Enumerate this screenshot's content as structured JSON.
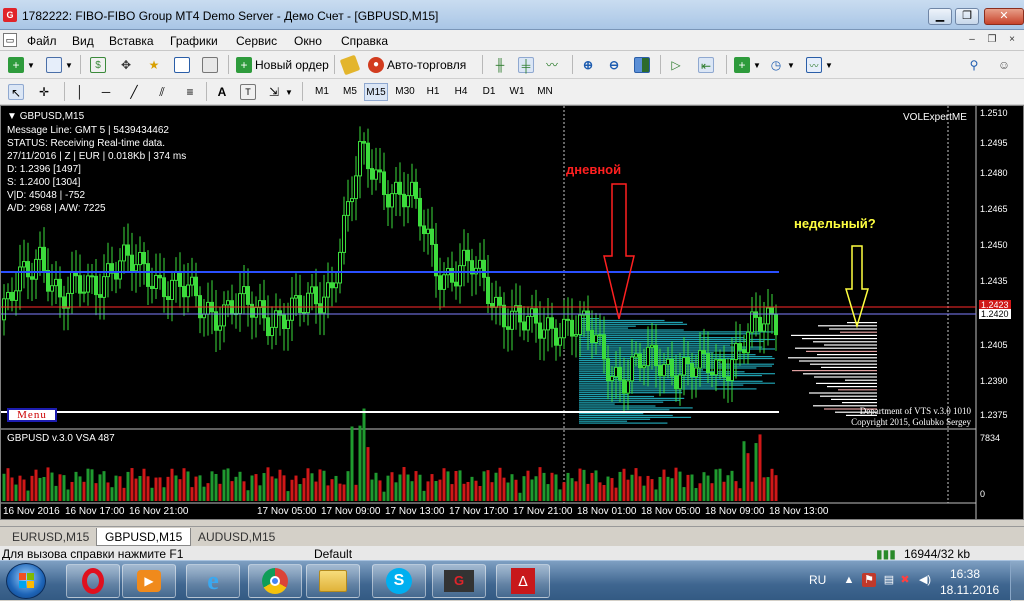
{
  "window": {
    "title": "1782222: FIBO-FIBO Group MT4 Demo Server - Демо Счет - [GBPUSD,M15]",
    "minimize": "▁",
    "restore": "❐",
    "close": "✕"
  },
  "menu": {
    "items": [
      "Файл",
      "Вид",
      "Вставка",
      "Графики",
      "Сервис",
      "Окно",
      "Справка"
    ],
    "mdi_minimize": "–",
    "mdi_restore": "❐",
    "mdi_close": "×"
  },
  "toolbar": {
    "new_order": "Новый ордер",
    "auto_trading": "Авто-торговля",
    "text_tool": "A",
    "timeframes": [
      "M1",
      "M5",
      "M15",
      "M30",
      "H1",
      "H4",
      "D1",
      "W1",
      "MN"
    ],
    "active_timeframe": "M15"
  },
  "chart": {
    "symbol_title": "GBPUSD,M15",
    "indicator_name": "VOLExpertME",
    "info_lines": [
      "Message Line: GMT 5 | 5439434462",
      "STATUS:  Receiving Real-time data.",
      "27/11/2016 | Z | EUR | 0.018Kb | 374 ms",
      "D: 1.2396  [1497]",
      "S: 1.2400  [1304]",
      "V|D: 45048 | -752",
      "A/D: 2968 | A/W: 7225"
    ],
    "annotation_daily": "дневной",
    "annotation_weekly": "недельный?",
    "menu_button": "Menu",
    "copyright_line1": "Department of VTS  v.3.0  1010",
    "copyright_line2": "Copyright 2015, Golubko Sergey",
    "price_labels": [
      "1.2510",
      "1.2495",
      "1.2480",
      "1.2465",
      "1.2450",
      "1.2435",
      "1.2420",
      "1.2405",
      "1.2390",
      "1.2375"
    ],
    "current_price": "1.2420",
    "bid_price": "1.2423",
    "volume_panel_title": "GBPUSD  v.3.0  VSA  487",
    "volume_max": "7834",
    "volume_min": "0",
    "time_labels": [
      "16 Nov 2016",
      "16 Nov 17:00",
      "16 Nov 21:00",
      "17 Nov 05:00",
      "17 Nov 09:00",
      "17 Nov 13:00",
      "17 Nov 17:00",
      "17 Nov 21:00",
      "18 Nov 01:00",
      "18 Nov 05:00",
      "18 Nov 09:00",
      "18 Nov 13:00"
    ],
    "colors": {
      "background": "#000000",
      "bull_candle": "#3cdc3c",
      "volume_up": "#1f9a2f",
      "volume_down": "#d01818",
      "resistance_line": "#2a4fff",
      "support_line": "#ff2a2a",
      "bid_tag": "#d01818",
      "profile": "#1fa0b0",
      "arrow_daily": "#ff2020",
      "arrow_weekly": "#ffff40"
    }
  },
  "tabs": [
    "EURUSD,M15",
    "GBPUSD,M15",
    "AUDUSD,M15"
  ],
  "active_tab": "GBPUSD,M15",
  "status": {
    "help": "Для вызова справки нажмите F1",
    "profile": "Default",
    "traffic": "16944/32 kb"
  },
  "taskbar": {
    "apps": [
      "opera",
      "media-player",
      "internet-explorer",
      "chrome",
      "file-explorer",
      "skype",
      "fibo-group",
      "acrobat"
    ],
    "language": "RU",
    "time": "16:38",
    "date": "18.11.2016"
  }
}
